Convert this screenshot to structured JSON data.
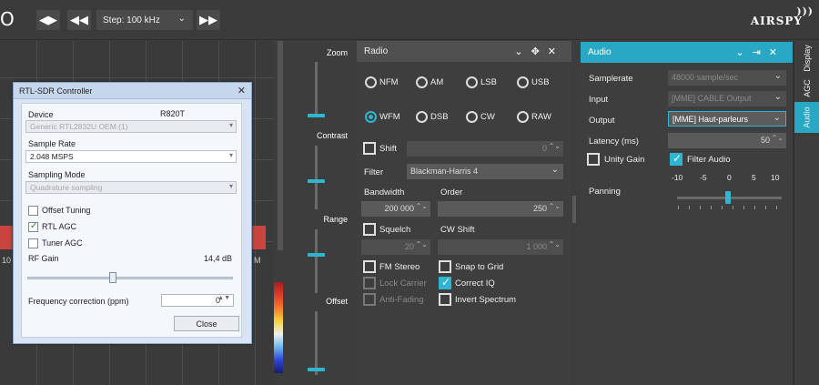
{
  "toolbar": {
    "stop_glyph": "O",
    "step_label": "Step: 100 kHz",
    "logo": "AIRSPY"
  },
  "spectrum": {
    "axis_left": "10",
    "axis_right": "M"
  },
  "sliders": {
    "zoom": "Zoom",
    "contrast": "Contrast",
    "range": "Range",
    "offset": "Offset"
  },
  "rtl_dialog": {
    "title": "RTL-SDR Controller",
    "device_label": "Device",
    "device_tuner": "R820T",
    "device_value": "Generic RTL2832U OEM (1)",
    "sample_rate_label": "Sample Rate",
    "sample_rate_value": "2.048 MSPS",
    "sampling_mode_label": "Sampling Mode",
    "sampling_mode_value": "Quadrature sampling",
    "offset_tuning": "Offset Tuning",
    "rtl_agc": "RTL AGC",
    "tuner_agc": "Tuner AGC",
    "rf_gain_label": "RF Gain",
    "rf_gain_value": "14,4 dB",
    "freq_corr_label": "Frequency correction (ppm)",
    "freq_corr_value": "0",
    "close": "Close"
  },
  "radio": {
    "title": "Radio",
    "modes": [
      "NFM",
      "AM",
      "LSB",
      "USB",
      "WFM",
      "DSB",
      "CW",
      "RAW"
    ],
    "selected_mode": "WFM",
    "shift_label": "Shift",
    "shift_value": "0",
    "filter_label": "Filter",
    "filter_value": "Blackman-Harris 4",
    "bandwidth_label": "Bandwidth",
    "bandwidth_value": "200 000",
    "order_label": "Order",
    "order_value": "250",
    "squelch_label": "Squelch",
    "squelch_value": "20",
    "cw_shift_label": "CW Shift",
    "cw_shift_value": "1 000",
    "fm_stereo": "FM Stereo",
    "snap_to_grid": "Snap to Grid",
    "lock_carrier": "Lock Carrier",
    "correct_iq": "Correct IQ",
    "anti_fading": "Anti-Fading",
    "invert_spectrum": "Invert Spectrum"
  },
  "audio": {
    "title": "Audio",
    "samplerate_label": "Samplerate",
    "samplerate_value": "48000 sample/sec",
    "input_label": "Input",
    "input_value": "[MME] CABLE Output",
    "output_label": "Output",
    "output_value": "[MME] Haut-parleurs",
    "latency_label": "Latency (ms)",
    "latency_value": "50",
    "unity_gain": "Unity Gain",
    "filter_audio": "Filter Audio",
    "panning_label": "Panning",
    "panning_ticks": [
      "-10",
      "-5",
      "0",
      "5",
      "10"
    ]
  },
  "side_tabs": [
    "Display",
    "AGC",
    "Audio"
  ],
  "colors": {
    "accent": "#2fb5cf",
    "panel_header_active": "#29a8c6",
    "spectrum_band": "#c8453f"
  }
}
